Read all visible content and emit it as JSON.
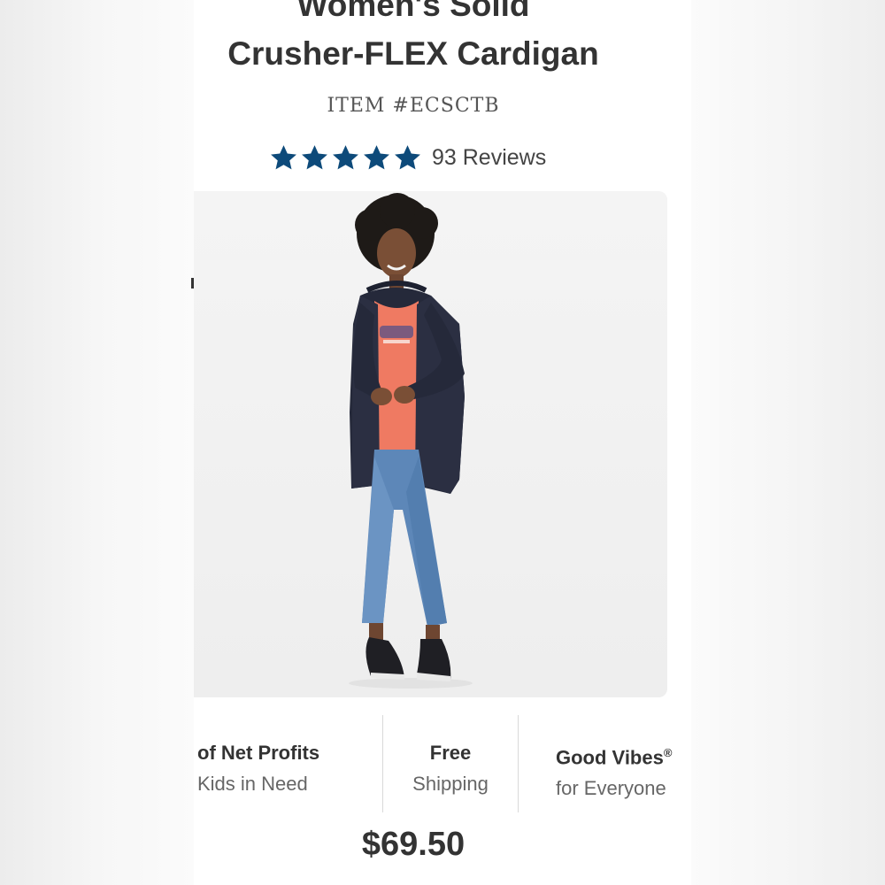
{
  "product": {
    "title_line1": "Women's Solid",
    "title_line2": "Crusher-FLEX Cardigan",
    "item_number": "ITEM #ECSCTB",
    "rating": 5,
    "rating_max": 5,
    "reviews_label": "93 Reviews",
    "price": "$69.50"
  },
  "icons": {
    "star": "star-icon",
    "star_color": "#0d4a7a"
  },
  "perks": [
    {
      "line1": "of Net Profits",
      "line2": "Kids in Need"
    },
    {
      "line1": "Free",
      "line2": "Shipping"
    },
    {
      "line1": "Good Vibes",
      "sup": "®",
      "line2": "for Everyone"
    }
  ],
  "image": {
    "subject": "model-wearing-cardigan"
  }
}
